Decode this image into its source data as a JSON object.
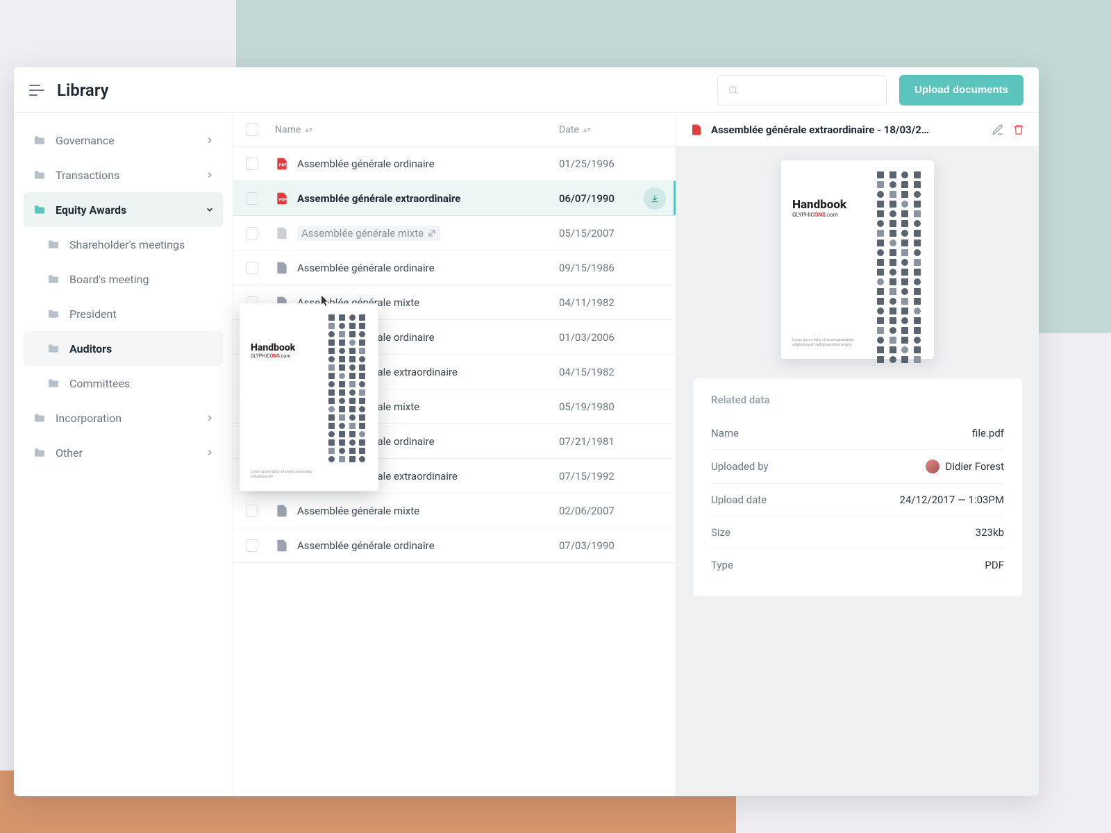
{
  "header": {
    "title": "Library",
    "upload_label": "Upload documents"
  },
  "sidebar": {
    "items": [
      {
        "label": "Governance",
        "expandable": true
      },
      {
        "label": "Transactions",
        "expandable": true
      },
      {
        "label": "Equity Awards",
        "expandable": true,
        "active": true
      },
      {
        "label": "Shareholder's meetings",
        "sub": true
      },
      {
        "label": "Board's meeting",
        "sub": true
      },
      {
        "label": "President",
        "sub": true
      },
      {
        "label": "Auditors",
        "sub": true,
        "sub_active": true
      },
      {
        "label": "Committees",
        "sub": true
      },
      {
        "label": "Incorporation",
        "expandable": true
      },
      {
        "label": "Other",
        "expandable": true
      }
    ]
  },
  "list": {
    "columns": {
      "name": "Name",
      "date": "Date"
    },
    "rows": [
      {
        "name": "Assemblée générale ordinaire",
        "date": "01/25/1996",
        "icon": "pdf"
      },
      {
        "name": "Assemblée générale extraordinaire",
        "date": "06/07/1990",
        "icon": "pdf",
        "selected": true,
        "downloadable": true
      },
      {
        "name": "Assemblée générale mixte",
        "date": "05/15/2007",
        "icon": "gray",
        "hover": true
      },
      {
        "name": "Assemblée générale ordinaire",
        "date": "09/15/1986",
        "icon": "gray"
      },
      {
        "name": "Assemblée générale mixte",
        "date": "04/11/1982",
        "icon": "gray"
      },
      {
        "name": "Assemblée générale ordinaire",
        "date": "01/03/2006",
        "icon": "gray"
      },
      {
        "name": "Assemblée générale extraordinaire",
        "date": "04/15/1982",
        "icon": "gray"
      },
      {
        "name": "Assemblée générale mixte",
        "date": "05/19/1980",
        "icon": "gray"
      },
      {
        "name": "Assemblée générale ordinaire",
        "date": "07/21/1981",
        "icon": "gray"
      },
      {
        "name": "Assemblée générale extraordinaire",
        "date": "07/15/1992",
        "icon": "gray"
      },
      {
        "name": "Assemblée générale mixte",
        "date": "02/06/2007",
        "icon": "gray"
      },
      {
        "name": "Assemblée générale ordinaire",
        "date": "07/03/1990",
        "icon": "gray"
      }
    ]
  },
  "detail": {
    "title": "Assemblée générale extraordinaire - 18/03/2…",
    "preview": {
      "title": "Handbook",
      "subtitle_prefix": "GLYPHIC",
      "subtitle_red": "ONS",
      "subtitle_suffix": ".com"
    },
    "meta_title": "Related data",
    "meta": [
      {
        "label": "Name",
        "value": "file.pdf"
      },
      {
        "label": "Uploaded by",
        "value": "Didier Forest",
        "avatar": true
      },
      {
        "label": "Upload date",
        "value": "24/12/2017 — 1:03PM"
      },
      {
        "label": "Size",
        "value": "323kb"
      },
      {
        "label": "Type",
        "value": "PDF"
      }
    ]
  }
}
